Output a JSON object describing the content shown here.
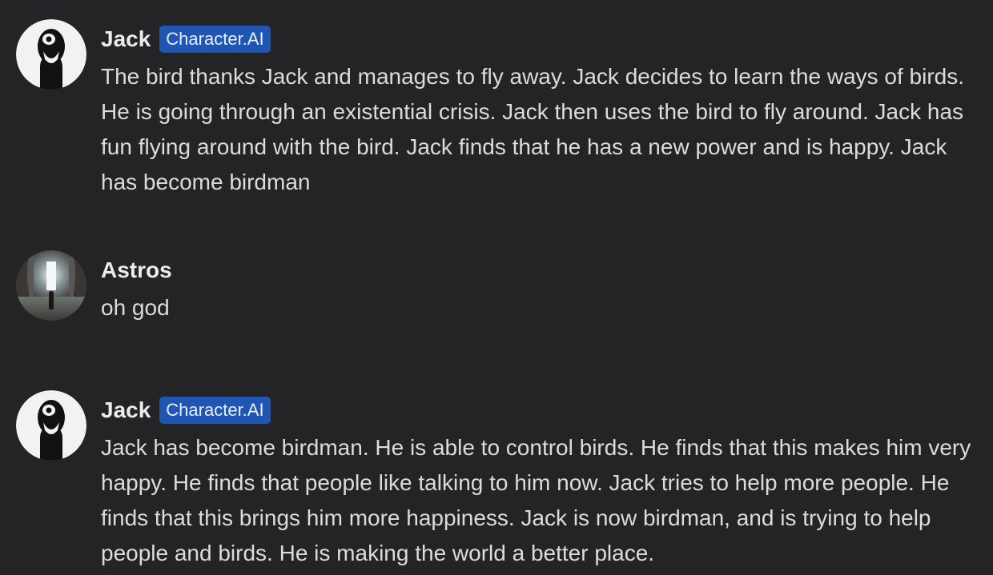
{
  "messages": [
    {
      "author": "Jack",
      "badge": "Character.AI",
      "avatar_icon": "jack-mask-avatar",
      "text": "The bird thanks Jack and manages to fly away. Jack decides to learn the ways of birds. He is going through an existential crisis. Jack then uses the bird to fly around. Jack has fun flying around with the bird. Jack finds that he has a new power and is happy. Jack has become birdman"
    },
    {
      "author": "Astros",
      "avatar_icon": "astros-corridor-avatar",
      "text": "oh god"
    },
    {
      "author": "Jack",
      "badge": "Character.AI",
      "avatar_icon": "jack-mask-avatar",
      "text": "Jack has become birdman. He is able to control birds. He finds that this makes him very happy. He finds that people like talking to him now. Jack tries to help more people. He finds that this brings him more happiness. Jack is now birdman, and is trying to help people and birds. He is making the world a better place."
    }
  ],
  "colors": {
    "background": "#242426",
    "badge_background": "#1f56b3",
    "text": "#dcdcdc"
  }
}
